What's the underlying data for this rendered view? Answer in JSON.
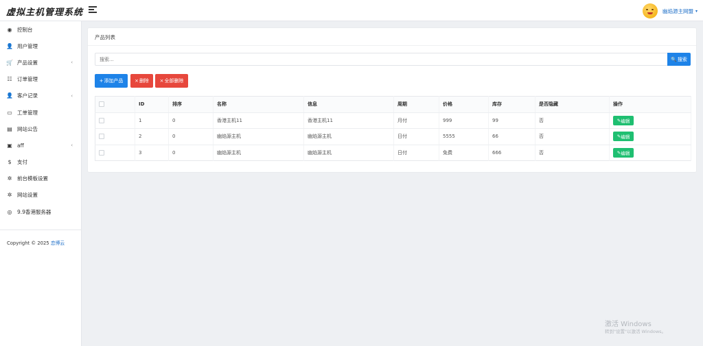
{
  "app": {
    "title": "虚拟主机管理系统"
  },
  "header": {
    "user_name": "幽焰源主网盟",
    "caret": "▾"
  },
  "sidebar": {
    "items": [
      {
        "label": "控制台",
        "icon": "◉",
        "icon_name": "dashboard-icon",
        "has_arrow": false
      },
      {
        "label": "用户管理",
        "icon": "👤",
        "icon_name": "user-icon",
        "has_arrow": false
      },
      {
        "label": "产品设置",
        "icon": "🛒",
        "icon_name": "cart-icon",
        "has_arrow": true
      },
      {
        "label": "订单管理",
        "icon": "☷",
        "icon_name": "list-icon",
        "has_arrow": false
      },
      {
        "label": "客户记录",
        "icon": "👤",
        "icon_name": "customer-icon",
        "has_arrow": true
      },
      {
        "label": "工单管理",
        "icon": "▭",
        "icon_name": "ticket-icon",
        "has_arrow": false
      },
      {
        "label": "网站公告",
        "icon": "▤",
        "icon_name": "announcement-icon",
        "has_arrow": false
      },
      {
        "label": "aff",
        "icon": "▣",
        "icon_name": "aff-icon",
        "has_arrow": true
      },
      {
        "label": "支付",
        "icon": "$",
        "icon_name": "dollar-icon",
        "has_arrow": false
      },
      {
        "label": "前台模板设置",
        "icon": "✲",
        "icon_name": "gear-icon",
        "has_arrow": false
      },
      {
        "label": "网站设置",
        "icon": "✲",
        "icon_name": "settings-icon",
        "has_arrow": false
      },
      {
        "label": "9.9香港服务器",
        "icon": "◎",
        "icon_name": "server-icon",
        "has_arrow": false
      }
    ],
    "copyright_prefix": "Copyright © 2025",
    "copyright_link": "恋博云"
  },
  "main": {
    "card_title": "产品列表",
    "search": {
      "placeholder": "搜索...",
      "button_label": "搜索",
      "button_icon": "🔍"
    },
    "actions": {
      "add": "添加产品",
      "delete": "删除",
      "delete_all": "全部删除"
    },
    "table": {
      "headers": [
        "ID",
        "排序",
        "名称",
        "信息",
        "周期",
        "价格",
        "库存",
        "是否隐藏",
        "操作"
      ],
      "rows": [
        [
          "1",
          "0",
          "香港主机11",
          "香港主机11",
          "月付",
          "999",
          "99",
          "否"
        ],
        [
          "2",
          "0",
          "幽焰源主机",
          "幽焰源主机",
          "日付",
          "5555",
          "66",
          "否"
        ],
        [
          "3",
          "0",
          "幽焰源主机",
          "幽焰源主机",
          "日付",
          "免费",
          "666",
          "否"
        ]
      ],
      "edit_label": "编辑"
    }
  },
  "watermark": {
    "line1": "激活 Windows",
    "line2": "转到\"设置\"以激活 Windows。"
  },
  "colors": {
    "primary": "#1e83e8",
    "danger": "#e7473c",
    "success": "#1fbf71"
  }
}
